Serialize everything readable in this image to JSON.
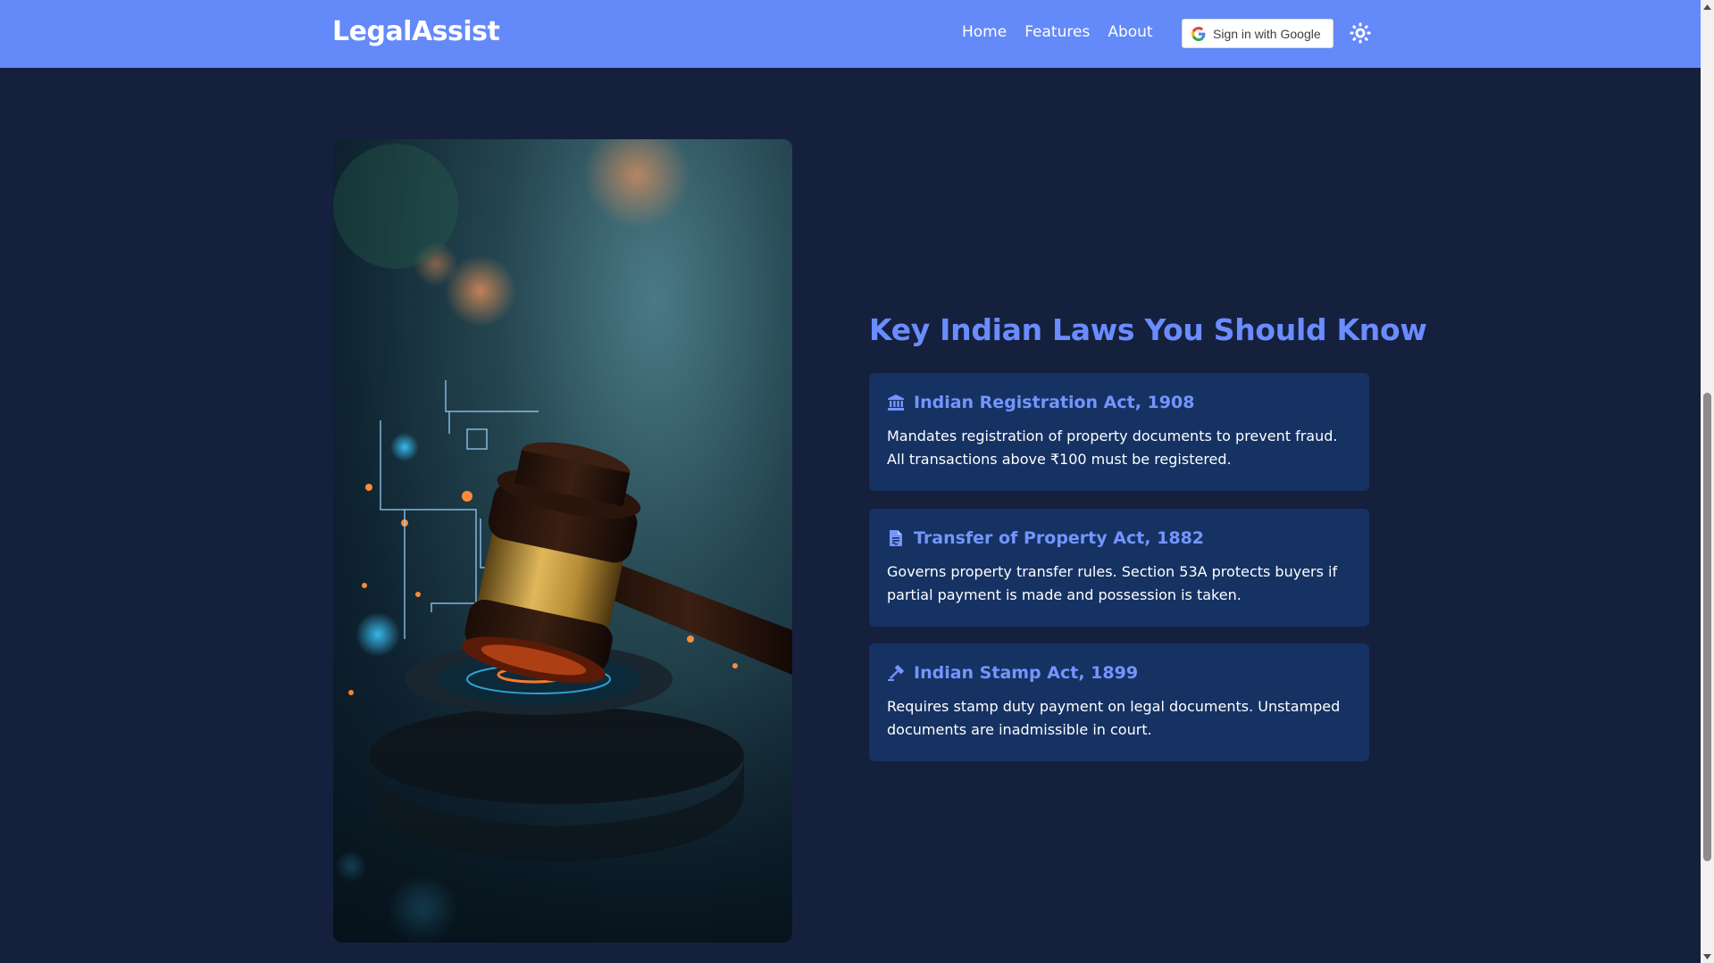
{
  "header": {
    "brand": "LegalAssist",
    "nav": [
      {
        "label": "Home"
      },
      {
        "label": "Features"
      },
      {
        "label": "About"
      }
    ],
    "signin_label": "Sign in with Google",
    "theme_icon": "sun-icon"
  },
  "hero": {
    "image_icon": "judge-gavel-image"
  },
  "laws_section": {
    "title": "Key Indian Laws You Should Know",
    "laws": [
      {
        "icon": "building-columns-icon",
        "title": "Indian Registration Act, 1908",
        "description": "Mandates registration of property documents to prevent fraud. All transactions above ₹100 must be registered."
      },
      {
        "icon": "file-contract-icon",
        "title": "Transfer of Property Act, 1882",
        "description": "Governs property transfer rules. Section 53A protects buyers if partial payment is made and possession is taken."
      },
      {
        "icon": "gavel-icon",
        "title": "Indian Stamp Act, 1899",
        "description": "Requires stamp duty payment on legal documents. Unstamped documents are inadmissible in court."
      }
    ]
  },
  "colors": {
    "navbar": "#6489f8",
    "background": "#15203d",
    "card": "#153263",
    "accent": "#6a8cff"
  }
}
